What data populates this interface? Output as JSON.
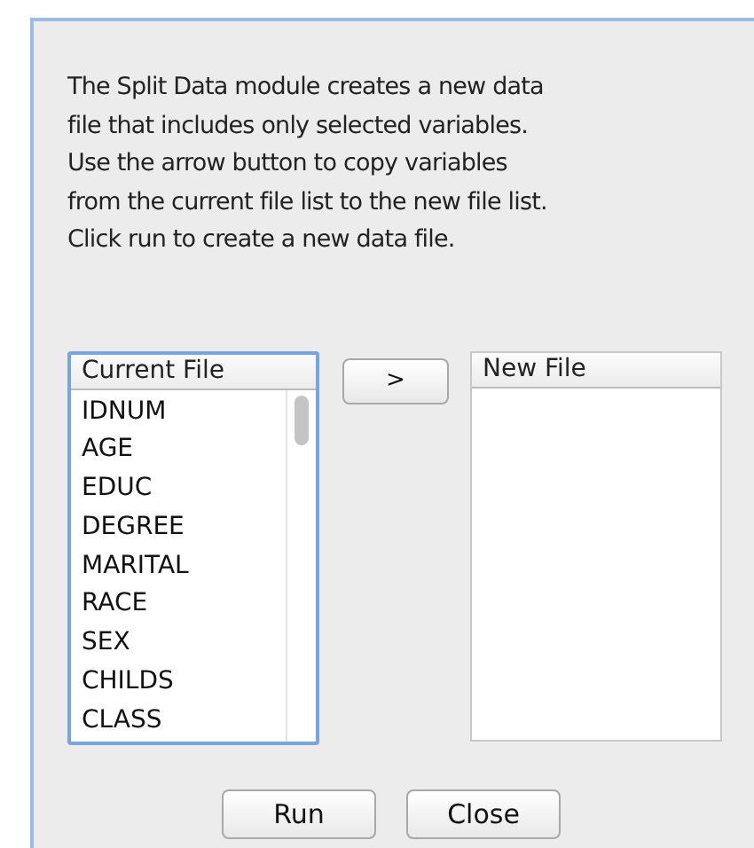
{
  "description_lines": [
    "The Split Data module creates a new data",
    "file that includes only selected variables.",
    "Use the arrow button to copy variables",
    "from the current file list to the new file list.",
    "Click run to create a new data file."
  ],
  "current_list": {
    "header": "Current File",
    "focused": true,
    "items": [
      "IDNUM",
      "AGE",
      "EDUC",
      "DEGREE",
      "MARITAL",
      "RACE",
      "SEX",
      "CHILDS",
      "CLASS"
    ]
  },
  "copy_button": ">",
  "new_list": {
    "header": "New File",
    "focused": false
  },
  "buttons": [
    "Run",
    "Close"
  ]
}
